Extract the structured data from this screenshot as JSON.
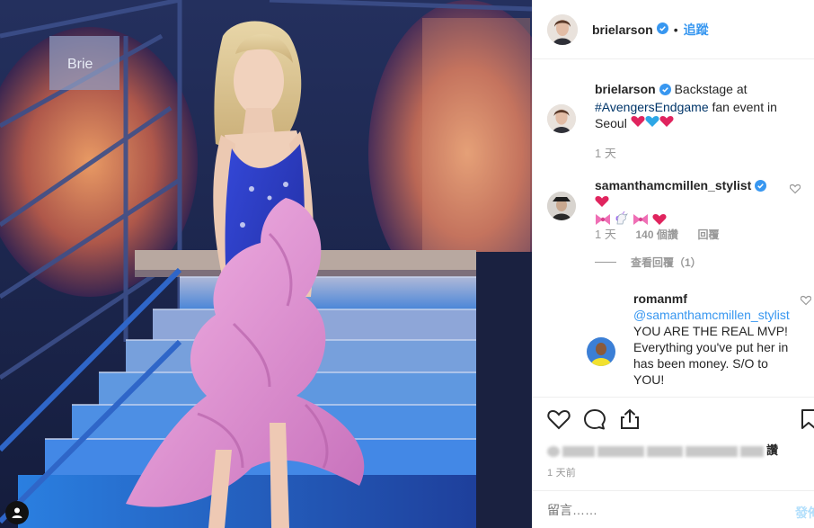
{
  "photo": {
    "sign_text": "Brie",
    "user_tag_icon": "user-icon"
  },
  "header": {
    "username": "brielarson",
    "follow_label": "追蹤",
    "separator": "•",
    "verified_icon": "verified-badge-icon"
  },
  "caption": {
    "username": "brielarson",
    "text_before": " Backstage at ",
    "hashtag": "#AvengersEndgame",
    "text_after": " fan event in Seoul ",
    "emojis": [
      "red-heart",
      "blue-heart",
      "red-heart"
    ],
    "time": "1 天"
  },
  "comments": [
    {
      "username": "samanthamcmillen_stylist",
      "emojis_line1": [
        "red-heart"
      ],
      "emojis_line2": [
        "pink-ribbon",
        "unicorn",
        "pink-ribbon",
        "red-heart"
      ],
      "time": "1 天",
      "likes": "140 個讚",
      "reply_label": "回覆",
      "view_replies": "查看回覆（1）"
    },
    {
      "username": "romanmf",
      "mention": "@samanthamcmillen_stylist",
      "text": " YOU ARE THE REAL MVP! Everything you've put her in has been money. S/O to YOU!"
    }
  ],
  "actions": {
    "icons": [
      "heart-icon",
      "comment-icon",
      "share-icon",
      "bookmark-icon"
    ],
    "likes_suffix": "讚",
    "timestamp": "1 天前"
  },
  "add_comment": {
    "placeholder": "留言……",
    "post_label": "發佈"
  },
  "colors": {
    "link": "#3897f0",
    "hashtag": "#003569",
    "muted": "#999999",
    "border": "#efefef",
    "dress_blue": "#2a3cc4",
    "dress_pink": "#e89ad6"
  }
}
